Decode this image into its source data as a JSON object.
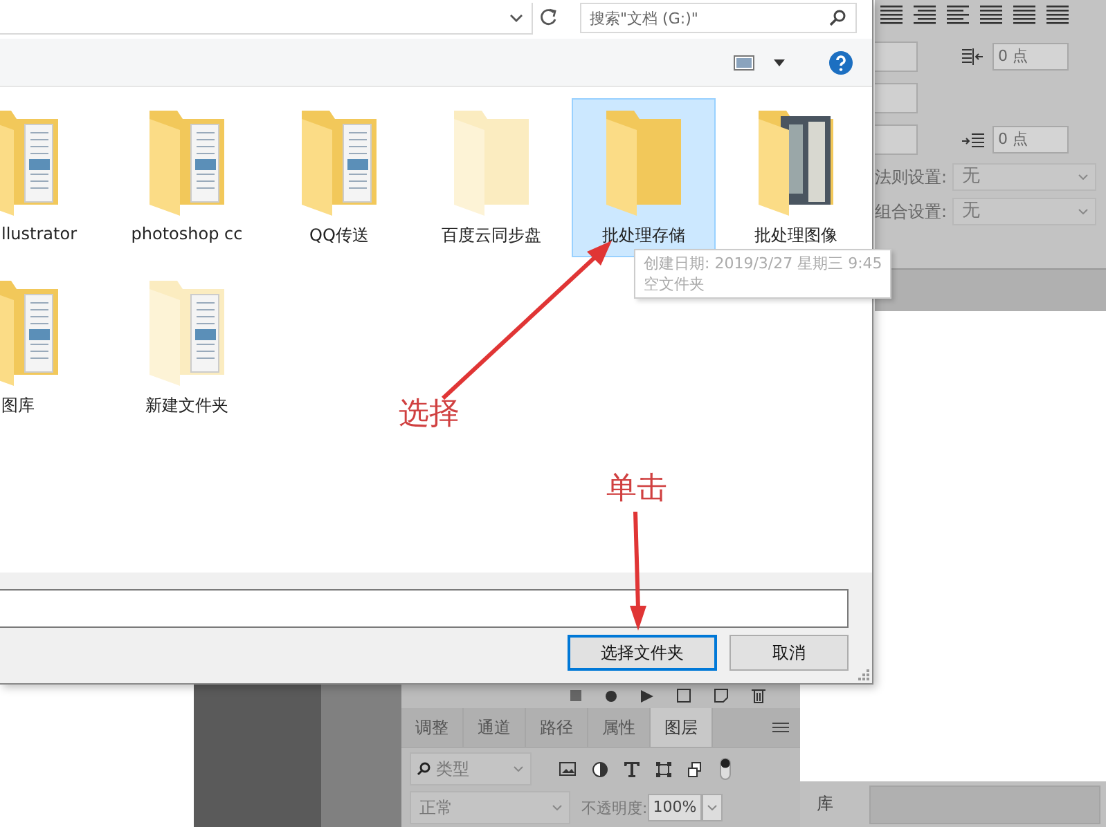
{
  "file_dialog": {
    "search_placeholder": "搜索\"文档 (G:)\"",
    "folders": [
      {
        "name": "llustrator",
        "kind": "documents",
        "faded": false,
        "selected": false
      },
      {
        "name": "photoshop cc",
        "kind": "documents",
        "faded": false,
        "selected": false
      },
      {
        "name": "QQ传送",
        "kind": "documents",
        "faded": false,
        "selected": false
      },
      {
        "name": "百度云同步盘",
        "kind": "empty",
        "faded": true,
        "selected": false
      },
      {
        "name": "批处理存储",
        "kind": "empty",
        "faded": false,
        "selected": true
      },
      {
        "name": "批处理图像",
        "kind": "photos",
        "faded": false,
        "selected": false
      },
      {
        "name": "图库",
        "kind": "documents",
        "faded": false,
        "selected": false
      },
      {
        "name": "新建文件夹",
        "kind": "documents",
        "faded": true,
        "selected": false
      }
    ],
    "tooltip": [
      "创建日期: 2019/3/27 星期三 9:45",
      "空文件夹"
    ],
    "buttons": [
      {
        "label": "选择文件夹",
        "selected": true
      },
      {
        "label": "取消",
        "selected": false
      }
    ]
  },
  "annotations": [
    {
      "text": "选择"
    },
    {
      "text": "单击"
    }
  ],
  "paragraph_panel": {
    "fields": [
      {
        "value": "0 点"
      },
      {
        "value": "0 点"
      }
    ],
    "settings": [
      {
        "label": "法则设置:",
        "value": "无"
      },
      {
        "label": "组合设置:",
        "value": "无"
      }
    ]
  },
  "layers_panel": {
    "tabs": [
      {
        "label": "调整",
        "selected": false
      },
      {
        "label": "通道",
        "selected": false
      },
      {
        "label": "路径",
        "selected": false
      },
      {
        "label": "属性",
        "selected": false
      },
      {
        "label": "图层",
        "selected": true
      }
    ],
    "filter": "类型",
    "blend_mode": "正常",
    "opacity_label": "不透明度:",
    "opacity": "100%"
  },
  "library_panel": {
    "title": "库"
  }
}
